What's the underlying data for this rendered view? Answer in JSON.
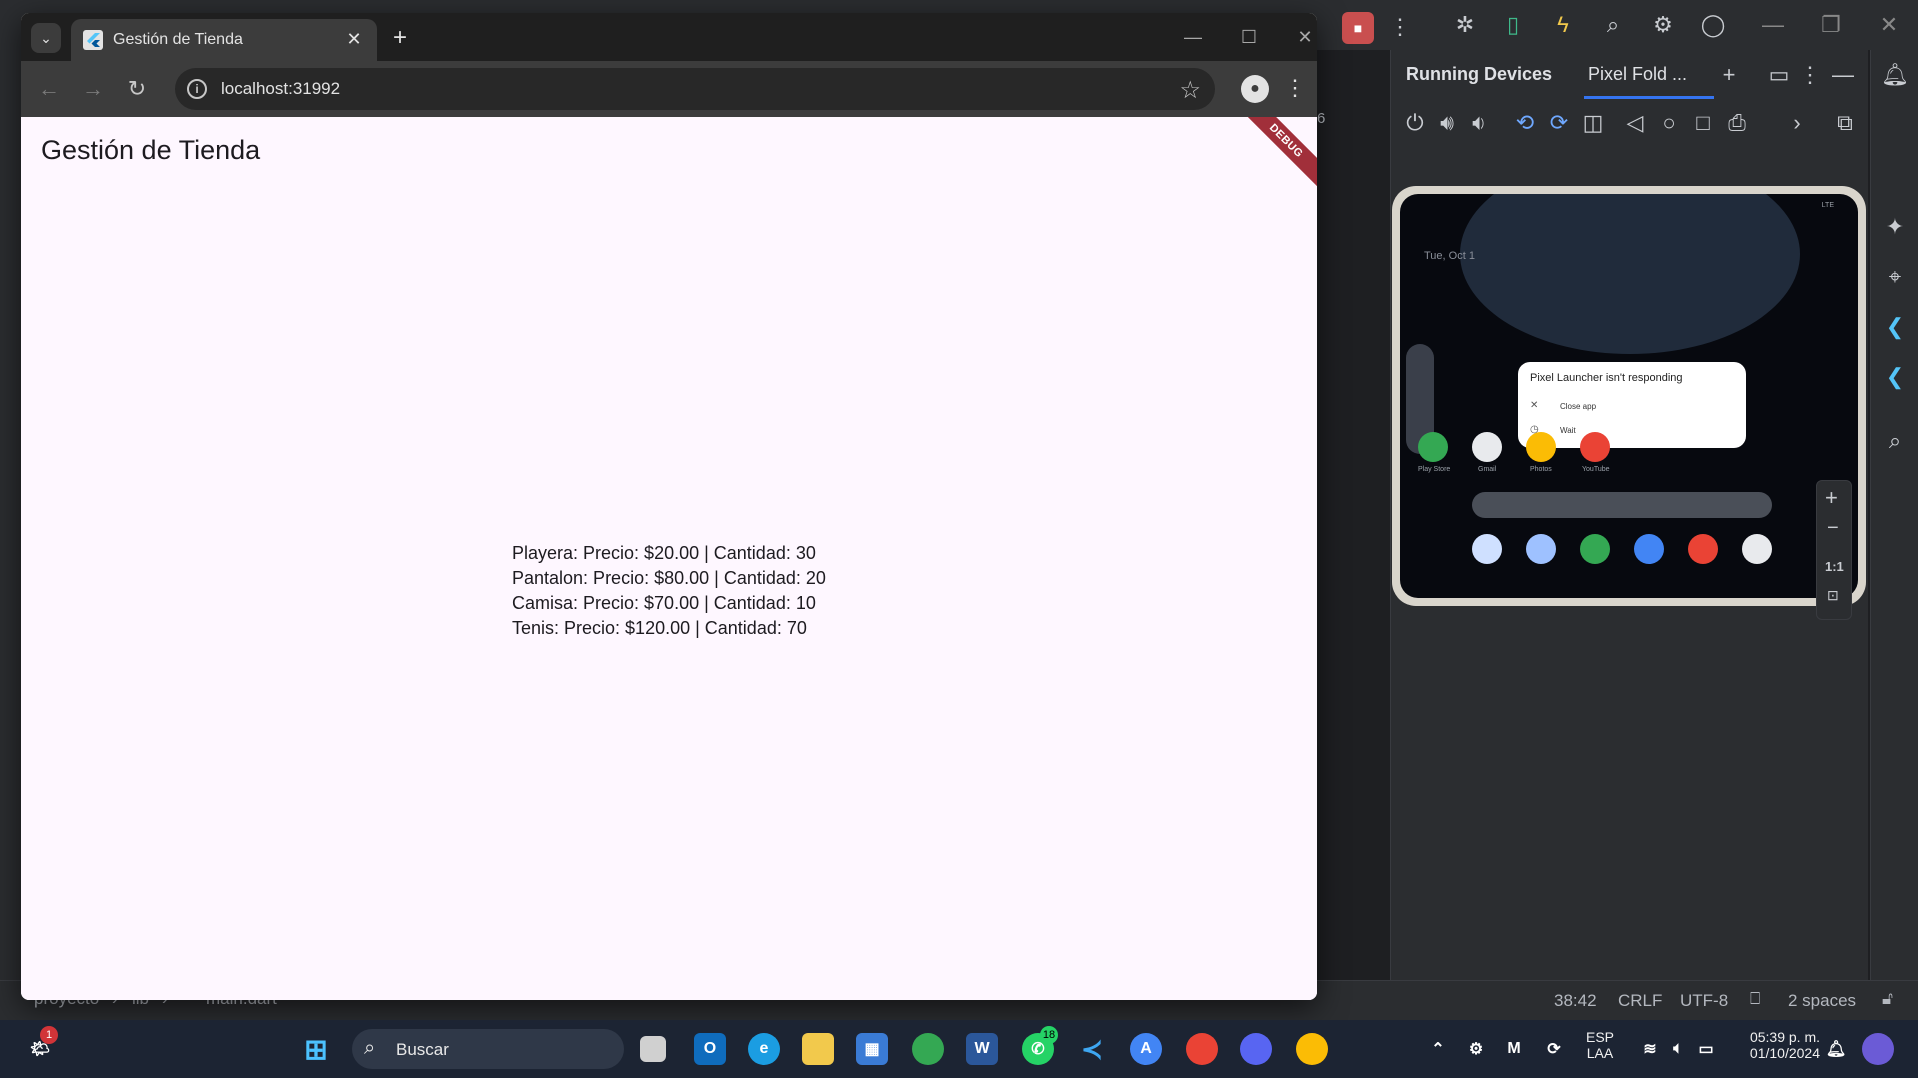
{
  "browser": {
    "tab_title": "Gestión de Tienda",
    "url": "localhost:31992"
  },
  "app": {
    "title": "Gestión de Tienda",
    "debug_label": "DEBUG",
    "products": [
      {
        "text": "Playera: Precio: $20.00 | Cantidad: 30"
      },
      {
        "text": "Pantalon: Precio: $80.00 | Cantidad: 20"
      },
      {
        "text": "Camisa: Precio: $70.00 | Cantidad: 10"
      },
      {
        "text": "Tenis: Precio: $120.00 | Cantidad: 70"
      }
    ]
  },
  "ide": {
    "panel_title": "Running Devices",
    "device_tab": "Pixel Fold ...",
    "line_hint": "6",
    "breadcrumb": [
      "proyecto",
      "lib",
      "main.dart"
    ],
    "status": {
      "position": "38:42",
      "line_sep": "CRLF",
      "encoding": "UTF-8",
      "indent": "2 spaces"
    }
  },
  "device": {
    "date": "Tue, Oct 1",
    "dialog_title": "Pixel Launcher isn't responding",
    "dialog_close": "Close app",
    "dialog_wait": "Wait",
    "apps": [
      "Play Store",
      "Gmail",
      "Photos",
      "YouTube"
    ],
    "zoom_label": "1:1",
    "status_right": "LTE"
  },
  "taskbar": {
    "search_placeholder": "Buscar",
    "lang_top": "ESP",
    "lang_bottom": "LAA",
    "time": "05:39 p. m.",
    "date": "01/10/2024",
    "whatsapp_badge": "18",
    "notif_badge": "1"
  },
  "colors": {
    "page_bg": "#fef7ff",
    "debug_banner": "#a12f3a",
    "ide_bg": "#1e1f22",
    "accent": "#3574f0"
  }
}
